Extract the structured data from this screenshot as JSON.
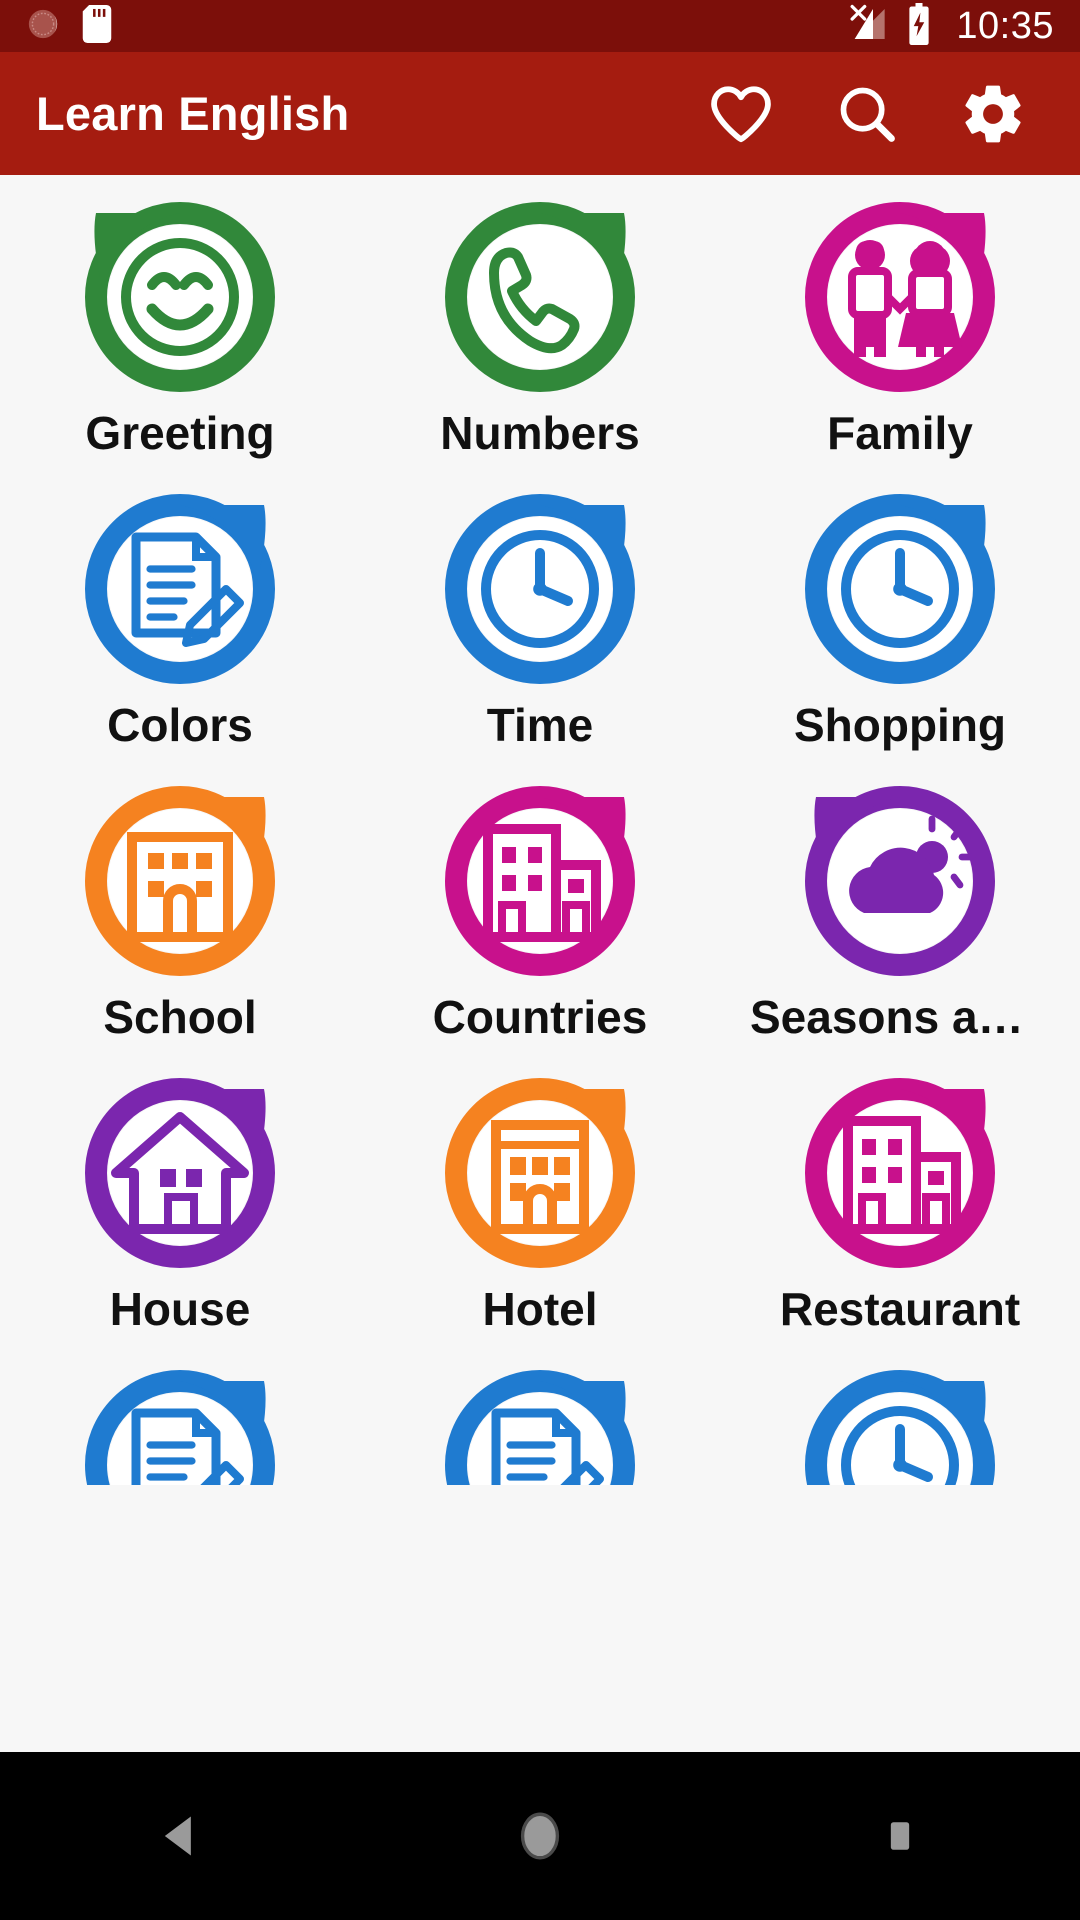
{
  "statusbar": {
    "icons": [
      "alarm-icon",
      "sd-card-icon"
    ],
    "signal_icon": "no-signal-icon",
    "battery_icon": "battery-charging-icon",
    "time": "10:35",
    "background": "#7c0f0a"
  },
  "appbar": {
    "title": "Learn English",
    "background": "#a51c10",
    "actions": [
      {
        "name": "favorite-icon",
        "label": "Favorites"
      },
      {
        "name": "search-icon",
        "label": "Search"
      },
      {
        "name": "settings-icon",
        "label": "Settings"
      }
    ]
  },
  "grid": {
    "items": [
      {
        "label": "Greeting",
        "icon": "smiley-face-icon",
        "color": "#31883a",
        "tail": "left"
      },
      {
        "label": "Numbers",
        "icon": "phone-handset-icon",
        "color": "#31883a",
        "tail": "right"
      },
      {
        "label": "Family",
        "icon": "two-children-icon",
        "color": "#c8118c",
        "tail": "right"
      },
      {
        "label": "Colors",
        "icon": "document-pencil-icon",
        "color": "#1f7bd0",
        "tail": "right"
      },
      {
        "label": "Time",
        "icon": "clock-icon",
        "color": "#1f7bd0",
        "tail": "right"
      },
      {
        "label": "Shopping",
        "icon": "clock-icon",
        "color": "#1f7bd0",
        "tail": "right"
      },
      {
        "label": "School",
        "icon": "school-building-icon",
        "color": "#f58220",
        "tail": "right"
      },
      {
        "label": "Countries",
        "icon": "city-building-icon",
        "color": "#c8118c",
        "tail": "right"
      },
      {
        "label": "Seasons and …",
        "icon": "cloud-sun-icon",
        "color": "#7b26ae",
        "tail": "left"
      },
      {
        "label": "House",
        "icon": "home-icon",
        "color": "#7b26ae",
        "tail": "right"
      },
      {
        "label": "Hotel",
        "icon": "hotel-building-icon",
        "color": "#f58220",
        "tail": "right"
      },
      {
        "label": "Restaurant",
        "icon": "city-building-icon",
        "color": "#c8118c",
        "tail": "right"
      }
    ],
    "partial_row": [
      {
        "label": "",
        "icon": "document-pencil-icon",
        "color": "#1f7bd0",
        "tail": "right"
      },
      {
        "label": "",
        "icon": "document-pencil-icon",
        "color": "#1f7bd0",
        "tail": "right"
      },
      {
        "label": "",
        "icon": "clock-icon",
        "color": "#1f7bd0",
        "tail": "right"
      }
    ]
  },
  "navbar": {
    "buttons": [
      {
        "name": "back-button",
        "icon": "triangle-left-icon"
      },
      {
        "name": "home-button",
        "icon": "circle-icon"
      },
      {
        "name": "recents-button",
        "icon": "square-icon"
      }
    ],
    "background": "#000000"
  }
}
